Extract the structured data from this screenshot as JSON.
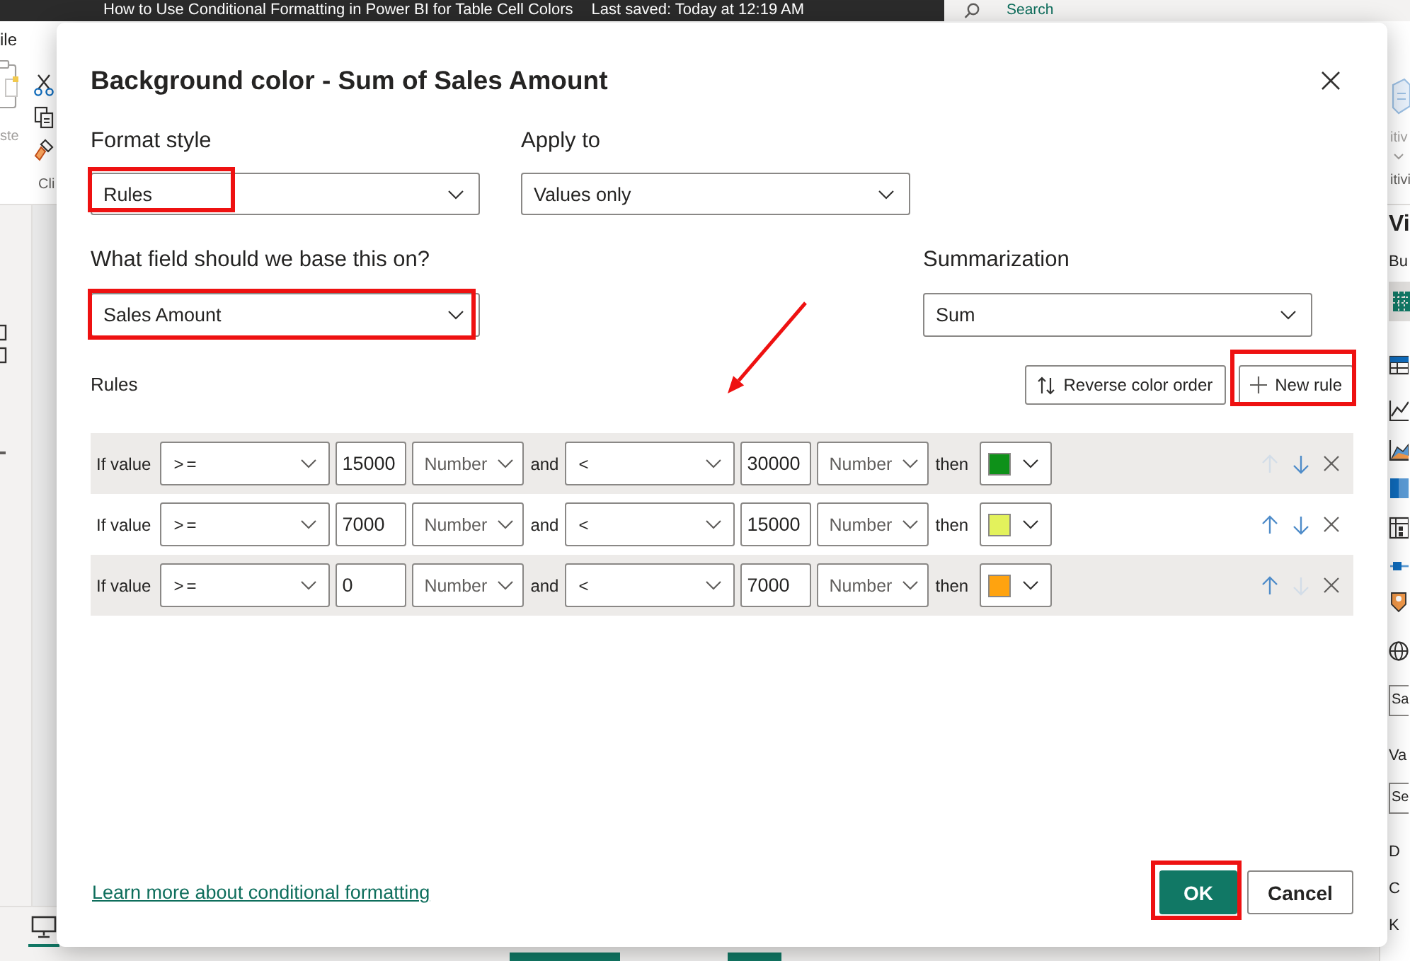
{
  "app": {
    "document_title": "How to Use Conditional Formatting in Power BI for Table Cell Colors",
    "save_status": "Last saved: Today at 12:19 AM",
    "search": {
      "placeholder": "Search"
    }
  },
  "ribbon": {
    "tab": "ile",
    "paste_label": "ste",
    "group_label": "Cli",
    "sensitivity_label": "itiv",
    "sensitivity_group": "itivi"
  },
  "visualizations_pane": {
    "title": "Vi",
    "build_label": "Bu",
    "items": [
      {
        "kind": "box",
        "text": "Sa"
      },
      {
        "kind": "label",
        "text": "Va"
      },
      {
        "kind": "box",
        "text": "Se"
      },
      {
        "kind": "label",
        "text": "D"
      },
      {
        "kind": "label",
        "text": "C"
      },
      {
        "kind": "label",
        "text": "K"
      }
    ]
  },
  "dialog": {
    "title": "Background color - Sum of Sales Amount",
    "format_style": {
      "label": "Format style",
      "value": "Rules",
      "highlighted": true
    },
    "apply_to": {
      "label": "Apply to",
      "value": "Values only",
      "highlighted": false
    },
    "base_field": {
      "label": "What field should we base this on?",
      "value": "Sales Amount",
      "highlighted": true
    },
    "summarization": {
      "label": "Summarization",
      "value": "Sum",
      "highlighted": false
    },
    "rules_label": "Rules",
    "reverse_button": {
      "label": "Reverse color order",
      "highlighted": false
    },
    "new_rule_button": {
      "label": "New rule",
      "highlighted": true
    },
    "rules": [
      {
        "prefix": "If value",
        "operator": ">=",
        "value": "15000",
        "type": "Number",
        "joiner": "and",
        "operator_2": "<",
        "value_2": "30000",
        "type_2": "Number",
        "suffix": "then",
        "color": "#0e9119",
        "up_disabled": true,
        "down_disabled": false
      },
      {
        "prefix": "If value",
        "operator": ">=",
        "value": "7000",
        "type": "Number",
        "joiner": "and",
        "operator_2": "<",
        "value_2": "15000",
        "type_2": "Number",
        "suffix": "then",
        "color": "#e3f25c",
        "up_disabled": false,
        "down_disabled": false
      },
      {
        "prefix": "If value",
        "operator": ">=",
        "value": "0",
        "type": "Number",
        "joiner": "and",
        "operator_2": "<",
        "value_2": "7000",
        "type_2": "Number",
        "suffix": "then",
        "color": "#ffa30f",
        "up_disabled": false,
        "down_disabled": true
      }
    ],
    "link": "Learn more about conditional formatting",
    "ok_button": {
      "label": "OK",
      "highlighted": true
    },
    "cancel_button": {
      "label": "Cancel",
      "highlighted": false
    }
  }
}
